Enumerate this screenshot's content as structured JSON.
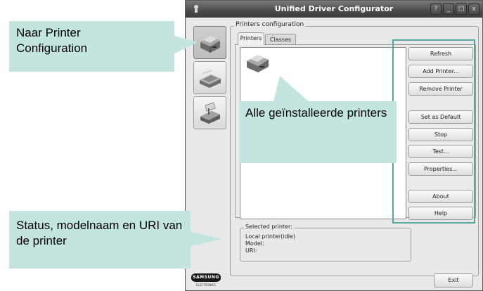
{
  "window": {
    "title": "Unified Driver Configurator",
    "controls": [
      "?",
      "_",
      "□",
      "x"
    ]
  },
  "nav": [
    {
      "name": "printer-configuration",
      "icon": "printer-icon",
      "active": true
    },
    {
      "name": "scanner-configuration",
      "icon": "scanner-icon",
      "active": false
    },
    {
      "name": "port-configuration",
      "icon": "port-icon",
      "active": false
    }
  ],
  "printers_group": {
    "legend": "Printers configuration",
    "tabs": [
      "Printers",
      "Classes"
    ]
  },
  "buttons": {
    "refresh": "Refresh",
    "add_printer": "Add Printer...",
    "remove_printer": "Remove Printer",
    "set_default": "Set as Default",
    "stop": "Stop",
    "test": "Test...",
    "properties": "Properties...",
    "about": "About",
    "help": "Help",
    "exit": "Exit"
  },
  "selected_printer": {
    "legend": "Selected printer:",
    "line1": "Local printer(idle)",
    "line2": "Model:",
    "line3": "URI:"
  },
  "logo": {
    "brand": "SAMSUNG",
    "sub": "ELECTRONICS"
  },
  "callouts": {
    "nav": "Naar Printer Configuration",
    "list": "Alle geïnstalleerde printers",
    "status": "Status, modelnaam en URI van de printer"
  },
  "colors": {
    "callout_bg": "#c4e4e0",
    "highlight": "#58a89e",
    "titlebar": "#4a4a4a"
  }
}
